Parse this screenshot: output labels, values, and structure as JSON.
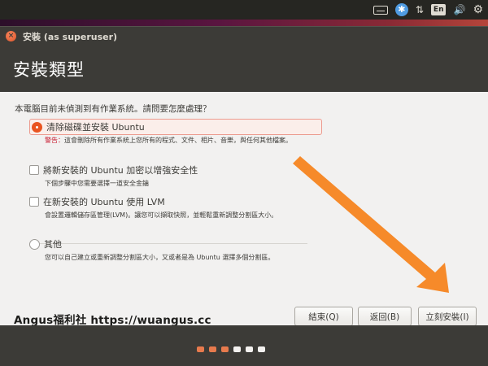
{
  "top_panel": {
    "icons": [
      "keyboard-icon",
      "accessibility-icon",
      "network-icon",
      "language-icon",
      "volume-icon",
      "settings-gear-icon"
    ],
    "language_label": "En",
    "accessibility_glyph": "✱",
    "network_glyph": "⇅",
    "volume_glyph": "🔊",
    "gear_glyph": "⚙"
  },
  "window": {
    "title": "安裝 (as superuser)",
    "close_glyph": "×"
  },
  "header": {
    "title": "安裝類型"
  },
  "main": {
    "question": "本電腦目前未偵測到有作業系統。請問要怎麼處理？",
    "options": [
      {
        "label": "清除磁碟並安裝 Ubuntu",
        "warning_prefix": "警告：",
        "description": "這會刪除所有作業系統上您所有的程式、文件、相片、音樂，與任何其他檔案。",
        "type": "radio",
        "selected": true
      },
      {
        "label": "將新安裝的 Ubuntu 加密以增強安全性",
        "description": "下個步驟中您需要選擇一道安全金鑰",
        "type": "checkbox",
        "checked": false
      },
      {
        "label": "在新安裝的 Ubuntu 使用 LVM",
        "description": "會設置邏輯儲存區管理(LVM)。讓您可以擷取快照，並輕鬆重新調整分割區大小。",
        "type": "checkbox",
        "checked": false
      },
      {
        "label": "其他",
        "description": "您可以自己建立或重新調整分割區大小，又或者是為 Ubuntu 選擇多個分割區。",
        "type": "radio",
        "selected": false
      }
    ]
  },
  "buttons": {
    "quit": "結束(Q)",
    "back": "返回(B)",
    "install_now": "立刻安裝(I)"
  },
  "watermark": "Angus福利社 https://wuangus.cc",
  "progress_dots": {
    "total": 6,
    "completed": 3
  },
  "colors": {
    "accent": "#e95420",
    "annotation_arrow": "#f5841f",
    "panel": "#3c3b37",
    "background": "#f2f1f0"
  }
}
